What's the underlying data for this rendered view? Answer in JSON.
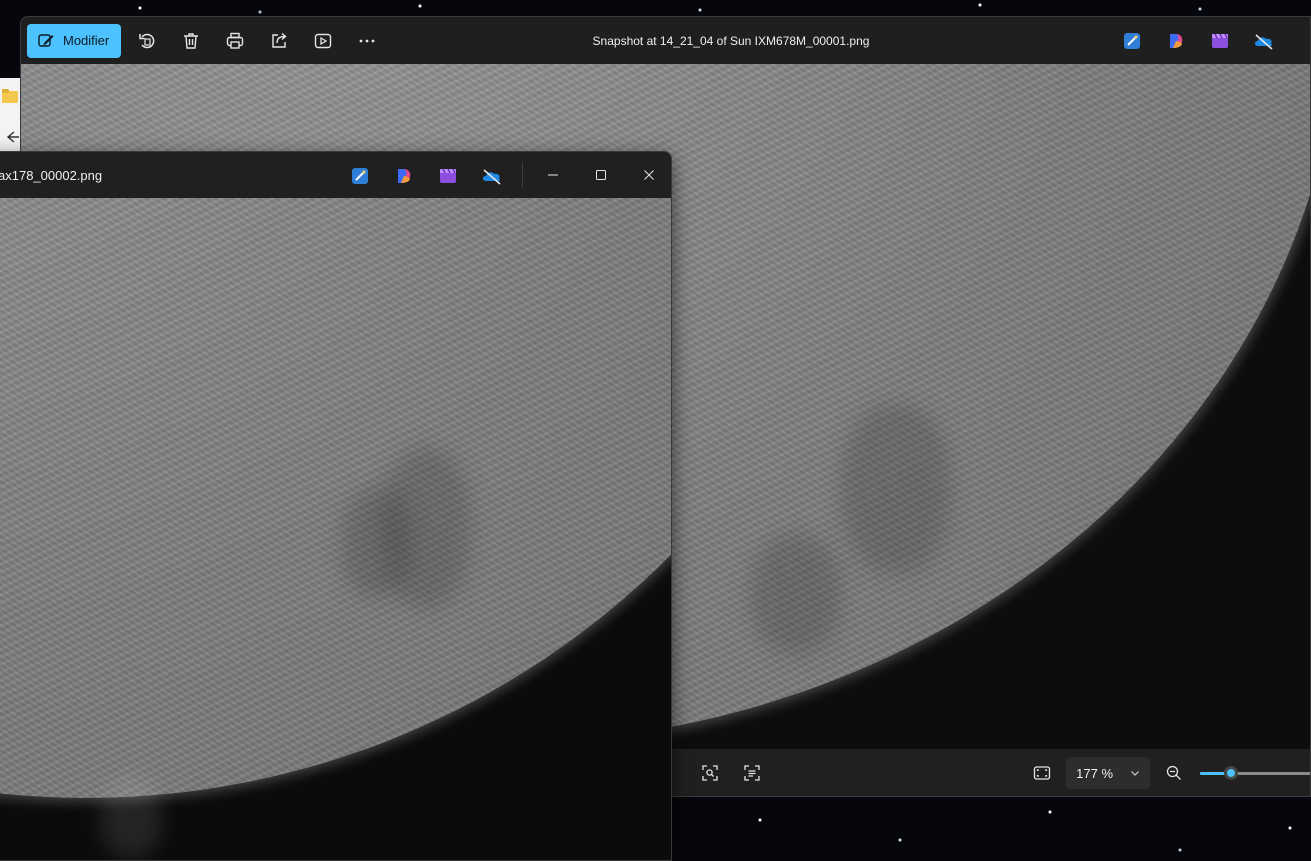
{
  "back_window": {
    "toolbar": {
      "edit_label": "Modifier",
      "icons": [
        "edit-icon",
        "rotate-icon",
        "delete-icon",
        "print-icon",
        "share-icon",
        "slideshow-icon",
        "more-icon"
      ]
    },
    "title": "Snapshot at 14_21_04 of Sun IXM678M_00001.png",
    "app_icons": [
      "designer-icon",
      "copilot-icon",
      "clipchamp-icon",
      "onedrive-icon"
    ],
    "status": {
      "zoom": "177 %",
      "zoom_slider_fraction": 0.28
    }
  },
  "front_window": {
    "title": "ax178_00002.png",
    "app_icons": [
      "designer-icon",
      "copilot-icon",
      "clipchamp-icon",
      "onedrive-icon"
    ],
    "controls": [
      "minimize-icon",
      "maximize-icon",
      "close-icon"
    ]
  },
  "colors": {
    "accent": "#4cc2ff",
    "toolbar_bg": "#1f1f1f",
    "status_bg": "#202020"
  }
}
